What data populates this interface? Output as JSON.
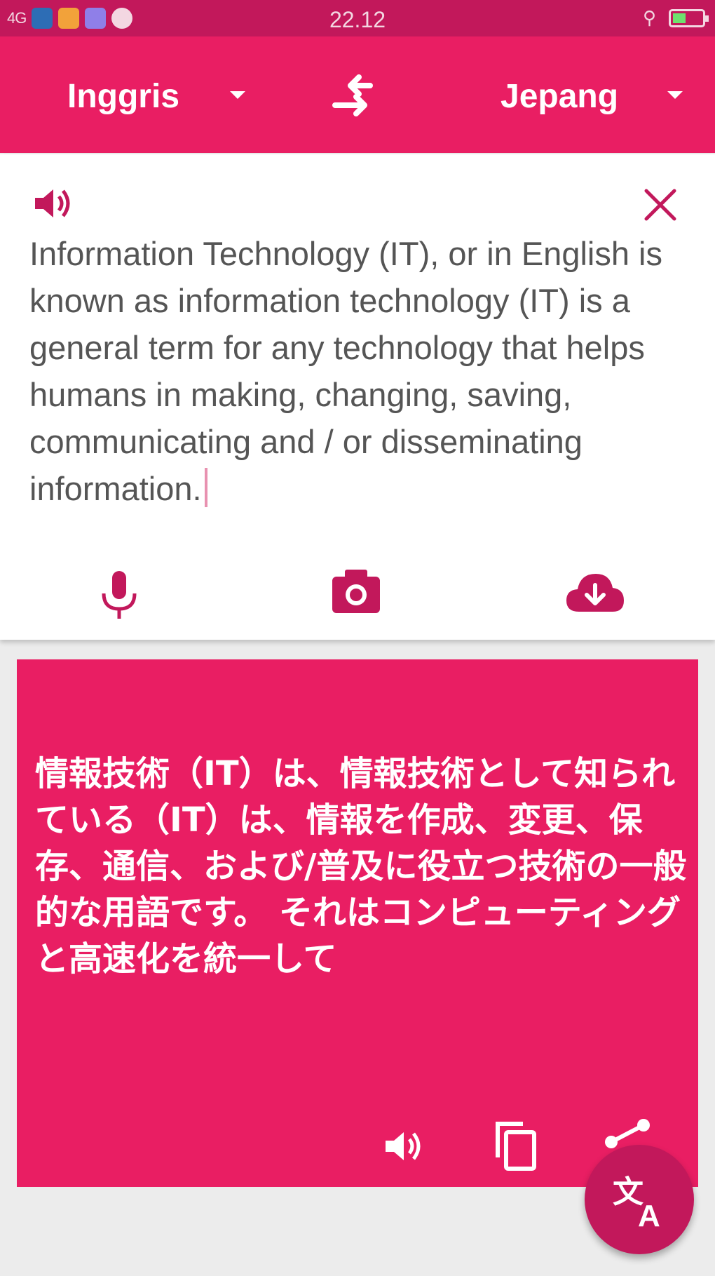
{
  "status_bar": {
    "time": "22.12",
    "network": "4G",
    "colors": {
      "bar": "#c2185b"
    }
  },
  "toolbar": {
    "source_language": "Inggris",
    "target_language": "Jepang",
    "swap_icon": "swap-arrows-icon",
    "color": "#e91e63"
  },
  "input": {
    "speaker_icon": "speaker-icon",
    "clear_icon": "close-icon",
    "text": "Information Technology (IT), or in English is known as information technology (IT) is a general term for any technology that helps humans in making, changing, saving, communicating and / or disseminating information.",
    "actions": [
      "mic-icon",
      "camera-icon",
      "cloud-download-icon"
    ]
  },
  "output": {
    "text": "情報技術（IT）は、情報技術として知られている（IT）は、情報を作成、変更、保存、通信、および/普及に役立つ技術の一般的な用語です。 それはコンピューティングと高速化を統一して",
    "actions": [
      "speaker-icon",
      "copy-icon",
      "share-icon"
    ],
    "color": "#e91e63"
  },
  "fab": {
    "icon": "translate-icon",
    "color": "#c2185b"
  }
}
